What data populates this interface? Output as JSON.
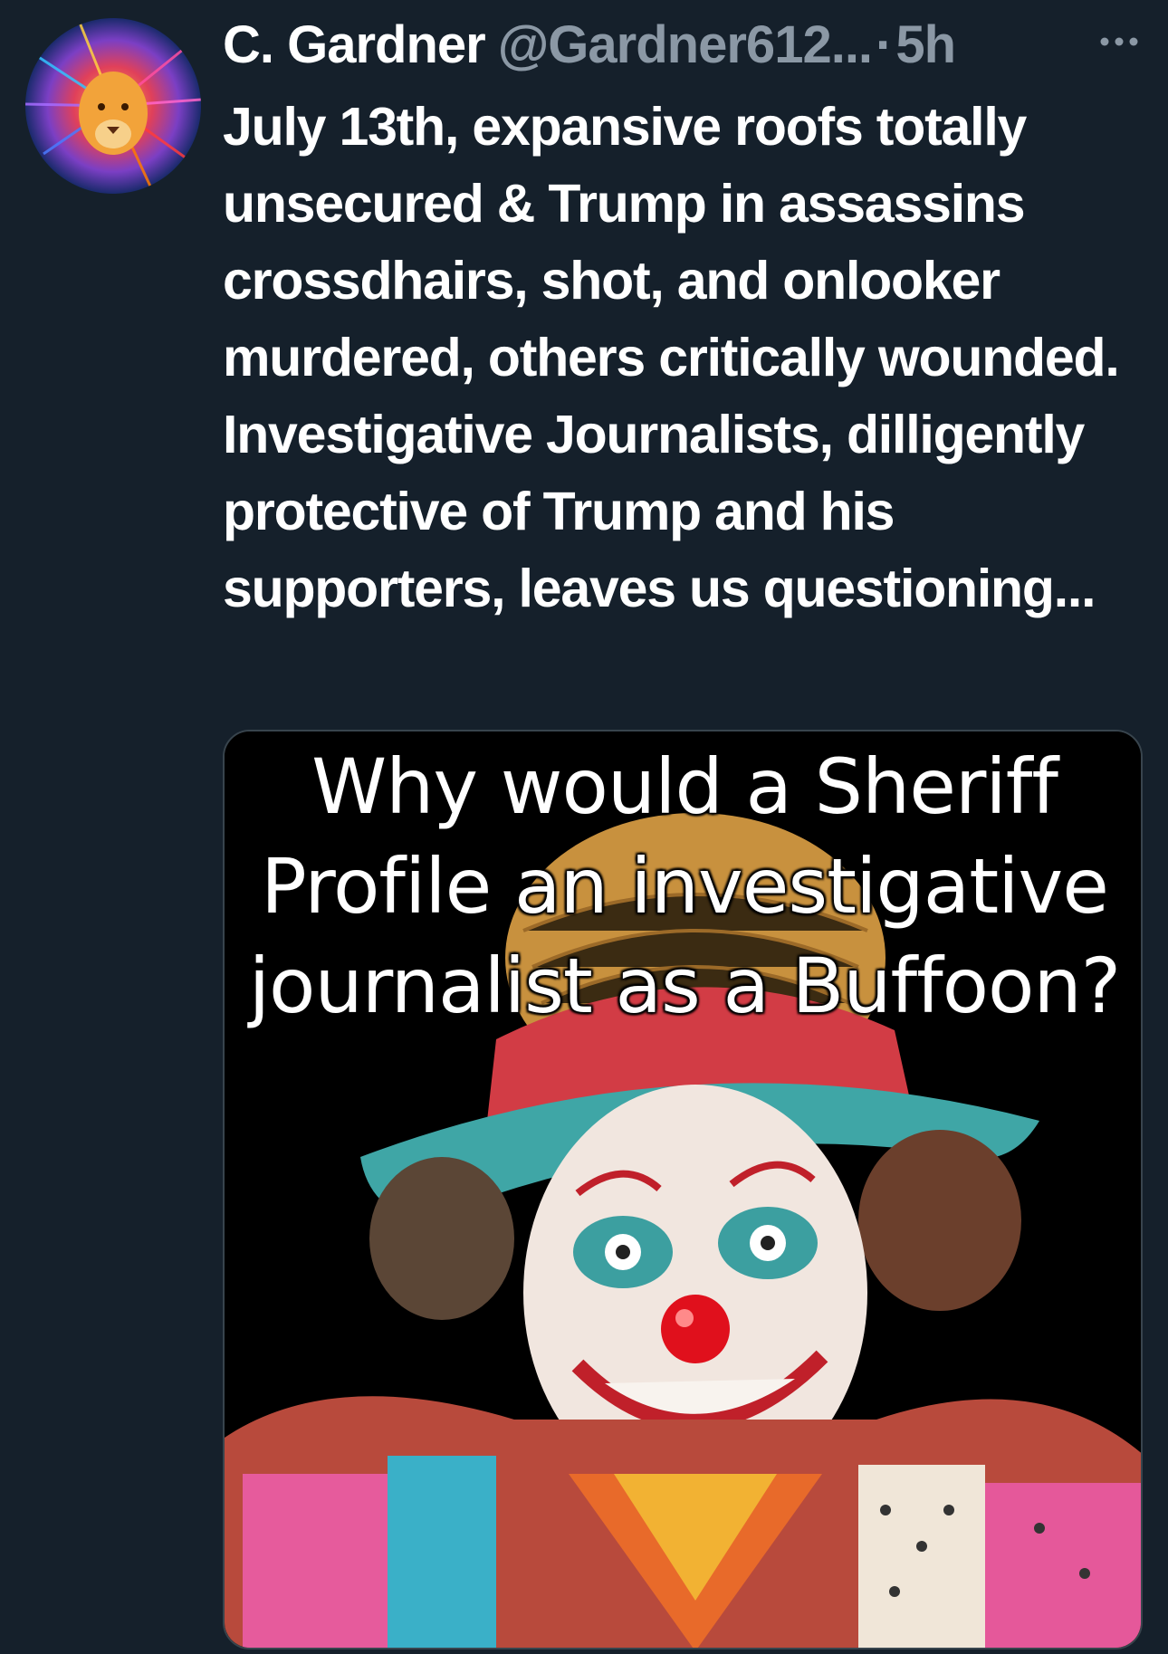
{
  "tweet": {
    "author": {
      "display_name": "C. Gardner",
      "handle": "@Gardner612...",
      "avatar_icon": "lion-avatar-icon"
    },
    "separator": "·",
    "timestamp": "5h",
    "more_icon": "more-options-icon",
    "text": "July 13th, expansive roofs totally unsecured & Trump in assassins crossdhairs, shot, and onlooker murdered, others critically wounded. Investigative Journalists, dilligently protective of Trump and his supporters, leaves us questioning...",
    "media": {
      "caption_lines": [
        "Why would a Sheriff",
        "Profile an investigative",
        "journalist as a Buffoon?"
      ],
      "image_icon": "clown-image"
    }
  },
  "colors": {
    "background": "#15202b",
    "text_primary": "#ffffff",
    "text_secondary": "#8b98a5",
    "media_border": "#38444d"
  }
}
